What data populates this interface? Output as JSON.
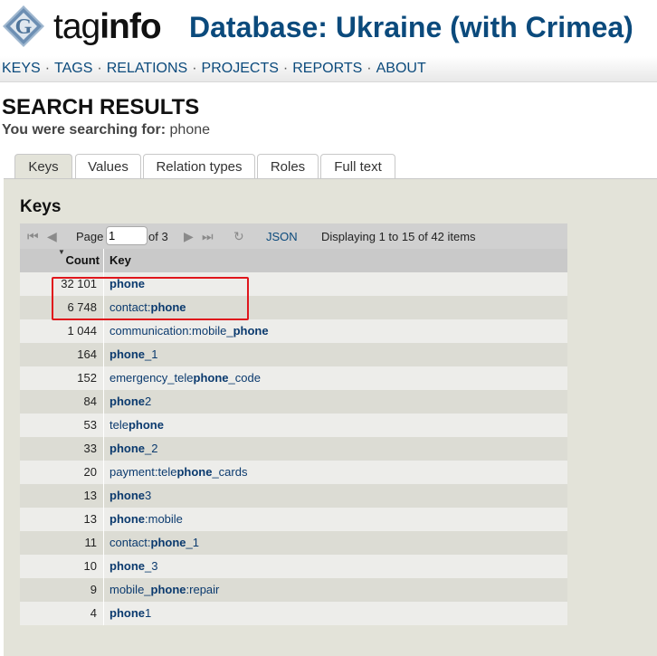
{
  "header": {
    "brand_tag": "tag",
    "brand_info": "info",
    "logo_letter": "G",
    "db_title": "Database: Ukraine (with Crimea)"
  },
  "nav": {
    "items": [
      "KEYS",
      "TAGS",
      "RELATIONS",
      "PROJECTS",
      "REPORTS",
      "ABOUT"
    ],
    "separator": "·"
  },
  "search": {
    "title": "SEARCH RESULTS",
    "prefix": "You were searching for:",
    "query": "phone"
  },
  "tabs": [
    "Keys",
    "Values",
    "Relation types",
    "Roles",
    "Full text"
  ],
  "panel": {
    "title": "Keys"
  },
  "toolbar": {
    "page_label": "Page",
    "page_value": "1",
    "of_label": "of 3",
    "json_label": "JSON",
    "display_text": "Displaying 1 to 15 of 42 items"
  },
  "table": {
    "columns": [
      "Count",
      "Key"
    ],
    "rows": [
      {
        "count": "32 101",
        "key": [
          [
            "phone",
            true
          ]
        ]
      },
      {
        "count": "6 748",
        "key": [
          [
            "contact:",
            false
          ],
          [
            "phone",
            true
          ]
        ]
      },
      {
        "count": "1 044",
        "key": [
          [
            "communication:mobile_",
            false
          ],
          [
            "phone",
            true
          ]
        ]
      },
      {
        "count": "164",
        "key": [
          [
            "phone",
            true
          ],
          [
            "_1",
            false
          ]
        ]
      },
      {
        "count": "152",
        "key": [
          [
            "emergency_tele",
            false
          ],
          [
            "phone",
            true
          ],
          [
            "_code",
            false
          ]
        ]
      },
      {
        "count": "84",
        "key": [
          [
            "phone",
            true
          ],
          [
            "2",
            false
          ]
        ]
      },
      {
        "count": "53",
        "key": [
          [
            "tele",
            false
          ],
          [
            "phone",
            true
          ]
        ]
      },
      {
        "count": "33",
        "key": [
          [
            "phone",
            true
          ],
          [
            "_2",
            false
          ]
        ]
      },
      {
        "count": "20",
        "key": [
          [
            "payment:tele",
            false
          ],
          [
            "phone",
            true
          ],
          [
            "_cards",
            false
          ]
        ]
      },
      {
        "count": "13",
        "key": [
          [
            "phone",
            true
          ],
          [
            "3",
            false
          ]
        ]
      },
      {
        "count": "13",
        "key": [
          [
            "phone",
            true
          ],
          [
            ":mobile",
            false
          ]
        ]
      },
      {
        "count": "11",
        "key": [
          [
            "contact:",
            false
          ],
          [
            "phone",
            true
          ],
          [
            "_1",
            false
          ]
        ]
      },
      {
        "count": "10",
        "key": [
          [
            "phone",
            true
          ],
          [
            "_3",
            false
          ]
        ]
      },
      {
        "count": "9",
        "key": [
          [
            "mobile_",
            false
          ],
          [
            "phone",
            true
          ],
          [
            ":repair",
            false
          ]
        ]
      },
      {
        "count": "4",
        "key": [
          [
            "phone",
            true
          ],
          [
            "1",
            false
          ]
        ]
      }
    ]
  },
  "colors": {
    "title_blue": "#0b4a7c",
    "link_blue": "#0b3a6e",
    "panel_bg": "#e3e3d9",
    "highlight_red": "#e0161c"
  }
}
